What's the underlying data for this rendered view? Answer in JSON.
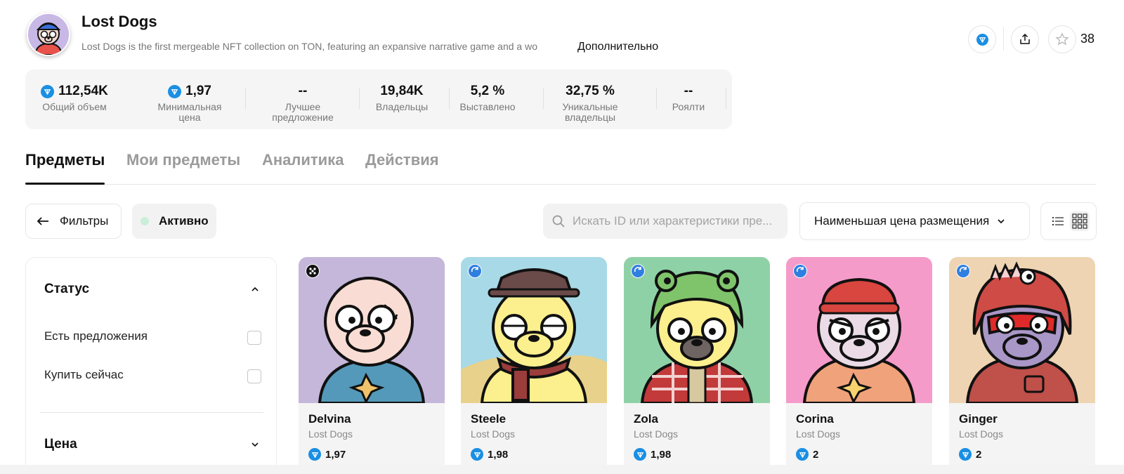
{
  "collection": {
    "title": "Lost Dogs",
    "description": "Lost Dogs is the first mergeable NFT collection on TON, featuring an expansive narrative game and a wo",
    "more_label": "Дополнительно",
    "favorites_count": "38"
  },
  "stats": [
    {
      "value": "112,54K",
      "label": "Общий объем",
      "ton": true
    },
    {
      "value": "1,97",
      "label": "Минимальная цена",
      "ton": true
    },
    {
      "value": "--",
      "label": "Лучшее предложение",
      "ton": false
    },
    {
      "value": "19,84K",
      "label": "Владельцы",
      "ton": false
    },
    {
      "value": "5,2 %",
      "label": "Выставлено",
      "ton": false
    },
    {
      "value": "32,75 %",
      "label": "Уникальные владельцы",
      "ton": false
    },
    {
      "value": "--",
      "label": "Роялти",
      "ton": false
    }
  ],
  "tabs": [
    {
      "label": "Предметы",
      "active": true
    },
    {
      "label": "Мои предметы",
      "active": false
    },
    {
      "label": "Аналитика",
      "active": false
    },
    {
      "label": "Действия",
      "active": false
    }
  ],
  "toolbar": {
    "filters_label": "Фильтры",
    "active_label": "Активно",
    "search_placeholder": "Искать ID или характеристики пре...",
    "sort_label": "Наименьшая цена размещения"
  },
  "filter_panel": {
    "status_title": "Статус",
    "options": [
      {
        "label": "Есть предложения",
        "checked": false
      },
      {
        "label": "Купить сейчас",
        "checked": false
      }
    ],
    "price_title": "Цена"
  },
  "items": [
    {
      "name": "Delvina",
      "collection": "Lost Dogs",
      "price": "1,97",
      "bg": "#c5b7da",
      "badge": "dice-icon"
    },
    {
      "name": "Steele",
      "collection": "Lost Dogs",
      "price": "1,98",
      "bg": "#a8d9e6",
      "badge": "refresh-icon"
    },
    {
      "name": "Zola",
      "collection": "Lost Dogs",
      "price": "1,98",
      "bg": "#8fd1a6",
      "badge": "refresh-icon"
    },
    {
      "name": "Corina",
      "collection": "Lost Dogs",
      "price": "2",
      "bg": "#f59bc9",
      "badge": "refresh-icon"
    },
    {
      "name": "Ginger",
      "collection": "Lost Dogs",
      "price": "2",
      "bg": "#eed4b2",
      "badge": "refresh-icon"
    }
  ],
  "colors": {
    "ton_blue": "#1a8fe3",
    "active_dot": "#c9efd9"
  }
}
